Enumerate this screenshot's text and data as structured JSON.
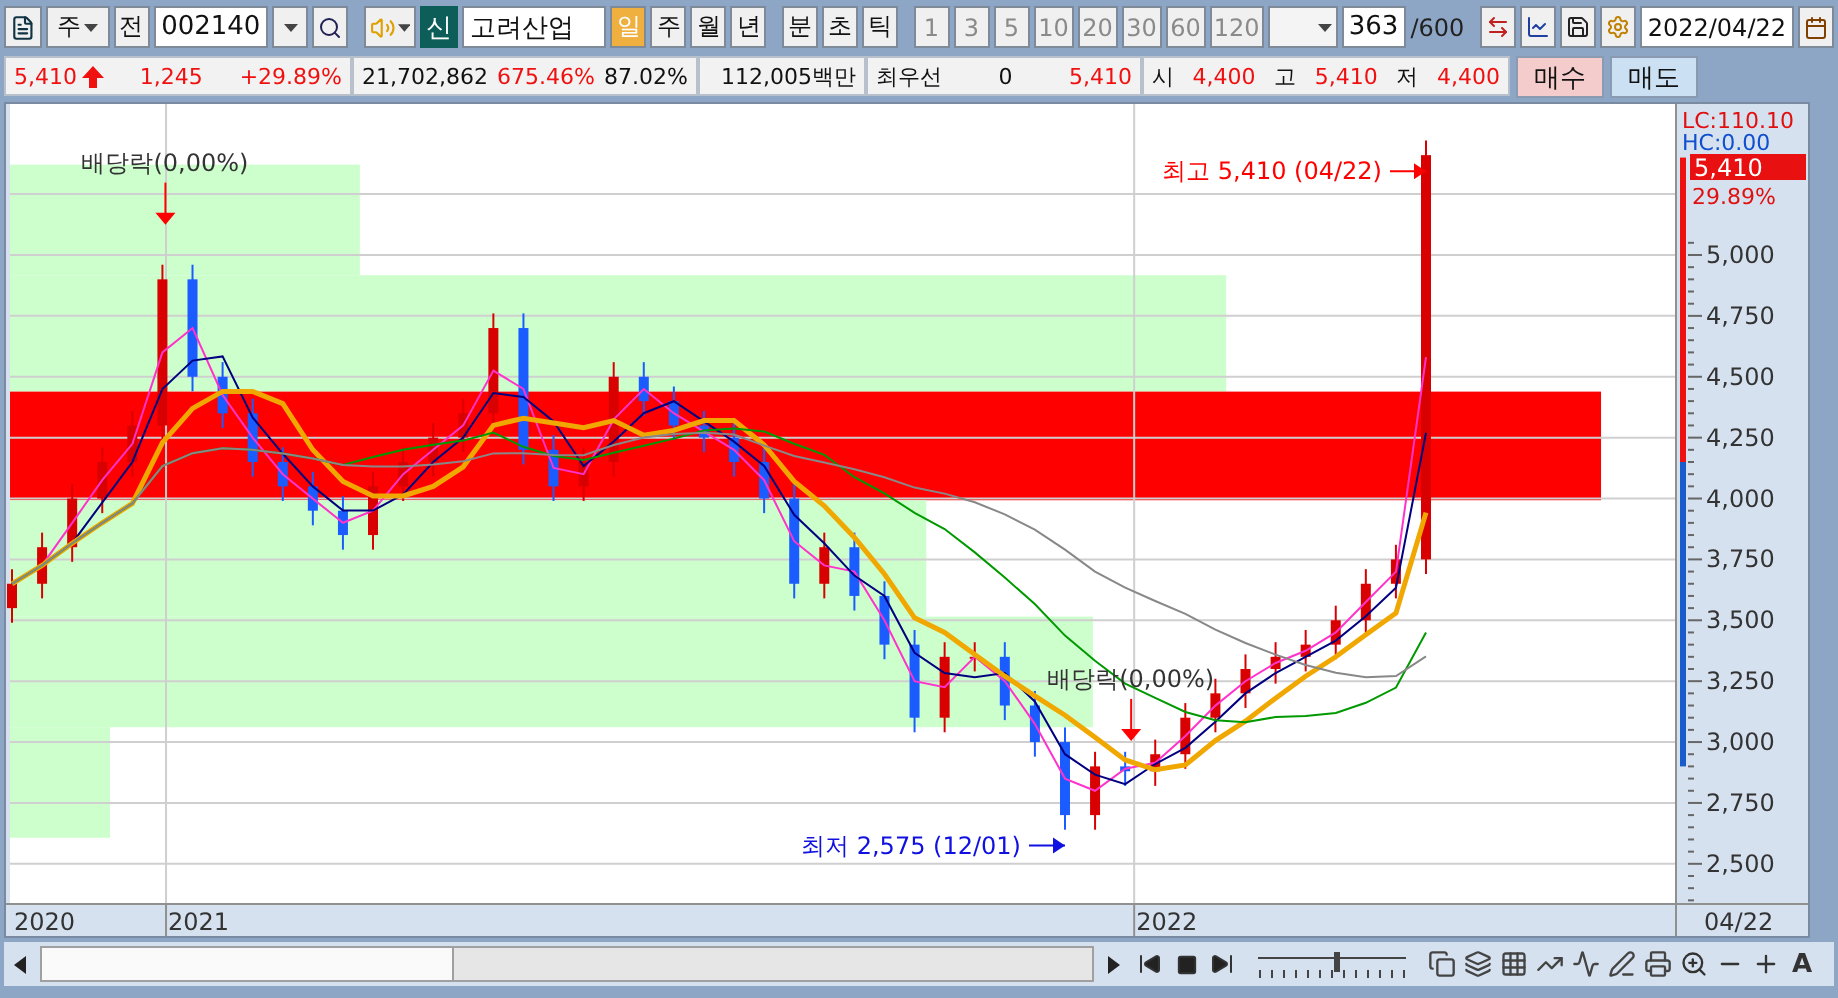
{
  "toolbar": {
    "market_combo": "주",
    "prev_button": "전",
    "code": "002140",
    "name_badge": "신",
    "name": "고려산업",
    "period_tabs": [
      {
        "label": "일",
        "selected": true
      },
      {
        "label": "주",
        "selected": false
      },
      {
        "label": "월",
        "selected": false
      },
      {
        "label": "년",
        "selected": false
      },
      {
        "label": "분",
        "selected": false
      },
      {
        "label": "초",
        "selected": false
      },
      {
        "label": "틱",
        "selected": false
      }
    ],
    "interval_buttons": [
      {
        "label": "1",
        "disabled": true
      },
      {
        "label": "3",
        "disabled": true
      },
      {
        "label": "5",
        "disabled": true
      },
      {
        "label": "10",
        "disabled": true
      },
      {
        "label": "20",
        "disabled": true
      },
      {
        "label": "30",
        "disabled": true
      },
      {
        "label": "60",
        "disabled": true
      },
      {
        "label": "120",
        "disabled": true
      }
    ],
    "count": "363",
    "max_count": "/600",
    "date": "2022/04/22"
  },
  "quote_bar": {
    "price": "5,410",
    "up": true,
    "change": "1,245",
    "change_rate": "+29.89%",
    "volume": "21,702,862",
    "volume_rate": "675.46%",
    "turnover": "87.02%",
    "amount": "112,005백만",
    "best_label": "최우선",
    "best_qty": "0",
    "best_price": "5,410",
    "open_label": "시",
    "open": "4,400",
    "high_label": "고",
    "high": "5,410",
    "low_label": "저",
    "low": "4,400",
    "buy": "매수",
    "sell": "매도"
  },
  "chart": {
    "price_labels": [
      "5,000",
      "4,750",
      "4,500",
      "4,250",
      "4,000",
      "3,750",
      "3,500",
      "3,250",
      "3,000",
      "2,750",
      "2,500"
    ],
    "date_labels": [
      "2020",
      "2021",
      "2022"
    ],
    "notes": [
      {
        "kind": "dividend",
        "label": "배당락(0,00%)"
      },
      {
        "kind": "dividend",
        "label": "배당락(0,00%)"
      },
      {
        "kind": "high",
        "label": "최고 5,410 (04/22)"
      },
      {
        "kind": "low",
        "label": "최저 2,575 (12/01)"
      }
    ],
    "axis_panel": {
      "lc": "LC:110.10",
      "hc": "HC:0.00",
      "last_price": "5,410",
      "last_change": "29.89%",
      "last_date": "04/22"
    }
  },
  "navigator": {
    "font_tool": "A"
  }
}
